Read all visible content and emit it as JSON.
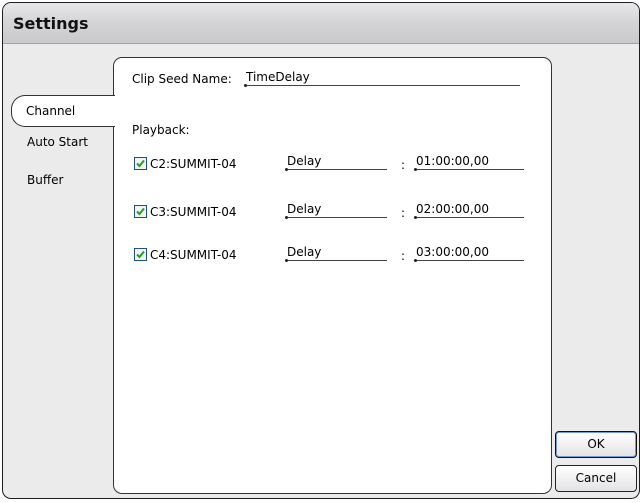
{
  "window": {
    "title": "Settings"
  },
  "tabs": [
    {
      "label": "Channel",
      "active": true
    },
    {
      "label": "Auto Start",
      "active": false
    },
    {
      "label": "Buffer",
      "active": false
    }
  ],
  "clip_seed": {
    "label": "Clip Seed Name:",
    "value": "TimeDelay"
  },
  "playback": {
    "label": "Playback:",
    "colon": ":",
    "rows": [
      {
        "checked": true,
        "channel": "C2:SUMMIT-04",
        "mode": "Delay",
        "time": "01:00:00,00"
      },
      {
        "checked": true,
        "channel": "C3:SUMMIT-04",
        "mode": "Delay",
        "time": "02:00:00,00"
      },
      {
        "checked": true,
        "channel": "C4:SUMMIT-04",
        "mode": "Delay",
        "time": "03:00:00,00"
      }
    ]
  },
  "buttons": {
    "ok": "OK",
    "cancel": "Cancel"
  },
  "colors": {
    "checkmark": "#21a121",
    "checkbox_border": "#1c5180"
  }
}
